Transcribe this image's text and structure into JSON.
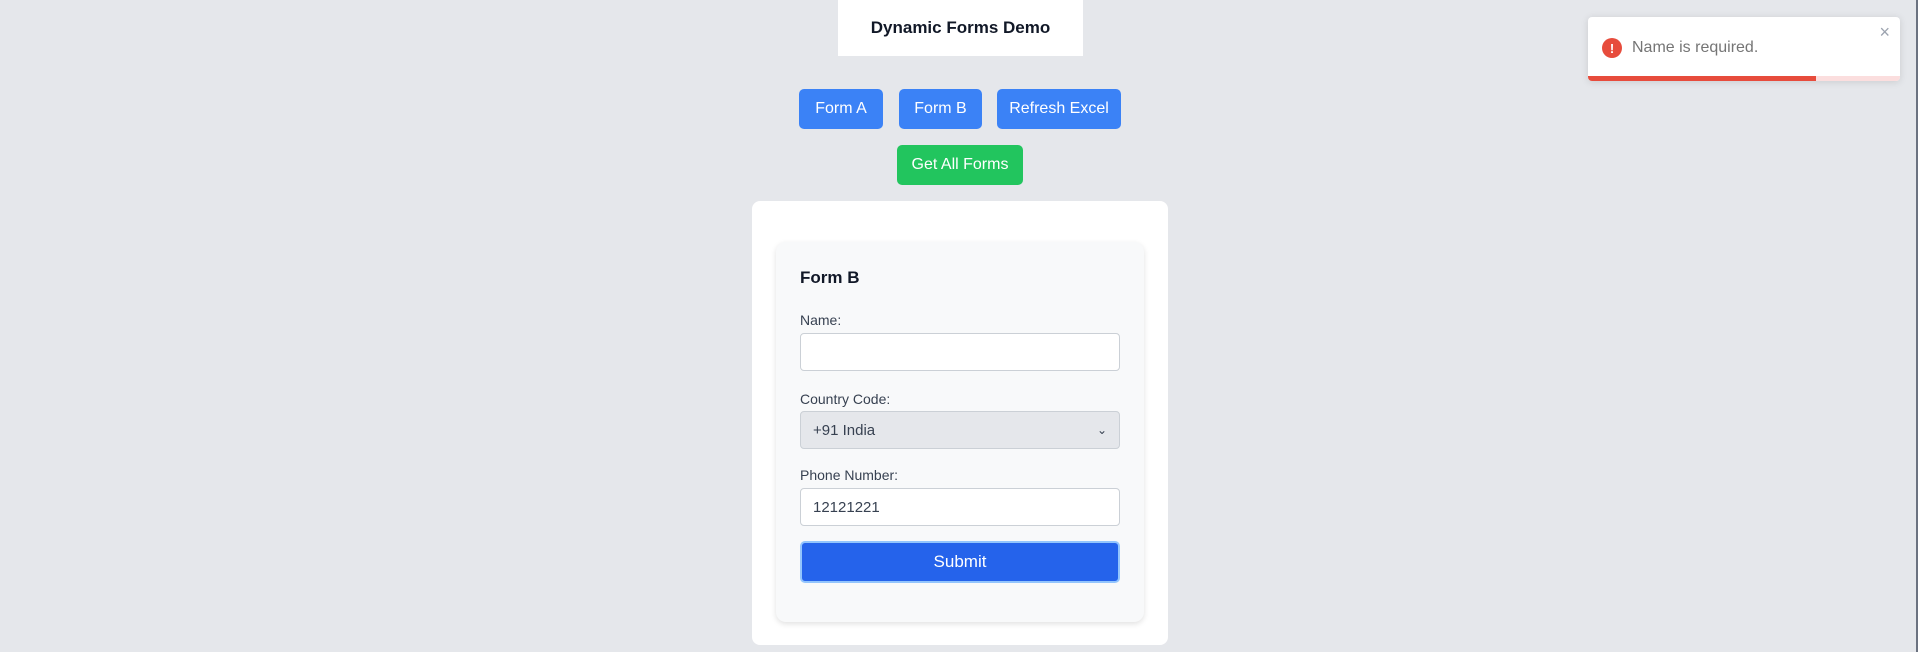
{
  "header": {
    "title": "Dynamic Forms Demo"
  },
  "toolbar": {
    "form_a_label": "Form A",
    "form_b_label": "Form B",
    "refresh_label": "Refresh Excel",
    "get_all_label": "Get All Forms"
  },
  "form": {
    "title": "Form B",
    "name_label": "Name:",
    "name_value": "",
    "country_label": "Country Code:",
    "country_selected": "+91 India",
    "phone_label": "Phone Number:",
    "phone_value": "12121221",
    "submit_label": "Submit"
  },
  "toast": {
    "message": "Name is required.",
    "icon": "error-icon",
    "close_symbol": "×",
    "progress_fraction": 0.73,
    "color": "#e74c3c"
  },
  "colors": {
    "primary": "#3b82f6",
    "success": "#22c55e",
    "submit": "#2563eb",
    "background": "#e5e7eb"
  }
}
